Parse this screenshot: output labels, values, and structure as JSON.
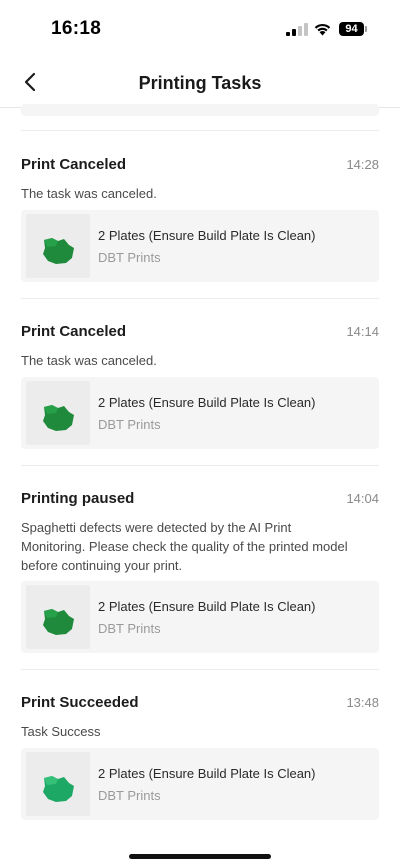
{
  "status_bar": {
    "time": "16:18",
    "battery": "94"
  },
  "header": {
    "title": "Printing Tasks"
  },
  "tasks": [
    {
      "title": "Print Canceled",
      "time": "14:28",
      "description": "The task was canceled.",
      "card": {
        "name": "2 Plates (Ensure Build Plate Is Clean)",
        "source": "DBT Prints"
      }
    },
    {
      "title": "Print Canceled",
      "time": "14:14",
      "description": "The task was canceled.",
      "card": {
        "name": "2 Plates (Ensure Build Plate Is Clean)",
        "source": "DBT Prints"
      }
    },
    {
      "title": "Printing paused",
      "time": "14:04",
      "description": "Spaghetti defects were detected by the AI Print Monitoring. Please check the quality of the printed model before continuing your print.",
      "card": {
        "name": "2 Plates (Ensure Build Plate Is Clean)",
        "source": "DBT Prints"
      }
    },
    {
      "title": "Print Succeeded",
      "time": "13:48",
      "description": "Task Success",
      "card": {
        "name": "2 Plates (Ensure Build Plate Is Clean)",
        "source": "DBT Prints"
      }
    }
  ],
  "colors": {
    "model_green": "#1f8a3b",
    "model_green_light": "#2db36a",
    "card_bg": "#f5f5f5"
  },
  "icons": {
    "back": "chevron-left-icon",
    "thumbnail": "3d-model-thumbnail"
  }
}
